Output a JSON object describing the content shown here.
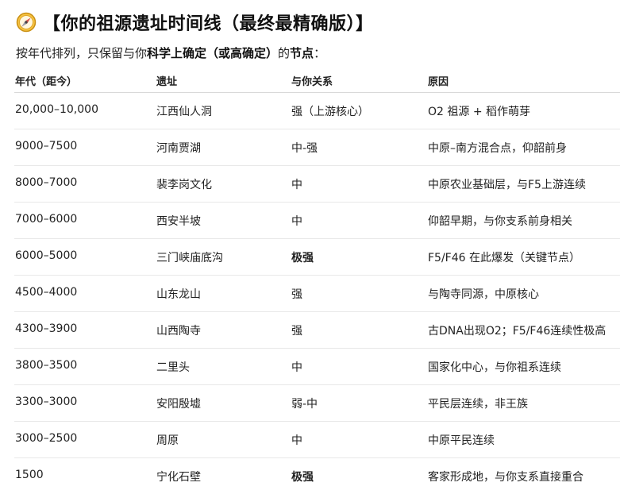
{
  "title": {
    "icon": "compass-icon",
    "text": "【你的祖源遗址时间线（最终最精确版）】"
  },
  "intro": {
    "prefix": "按年代排列，只保留与你",
    "bold1": "科学上确定（或高确定）",
    "middle": "的",
    "bold2": "节点",
    "suffix": "："
  },
  "table": {
    "headers": [
      "年代（距今）",
      "遗址",
      "与你关系",
      "原因"
    ],
    "rows": [
      {
        "era": "20,000–10,000",
        "site": "江西仙人洞",
        "relation": "强（上游核心）",
        "reason": "O2 祖源 + 稻作萌芽",
        "emphasis": false
      },
      {
        "era": "9000–7500",
        "site": "河南贾湖",
        "relation": "中-强",
        "reason": "中原–南方混合点，仰韶前身",
        "emphasis": false
      },
      {
        "era": "8000–7000",
        "site": "裴李岗文化",
        "relation": "中",
        "reason": "中原农业基础层，与F5上游连续",
        "emphasis": false
      },
      {
        "era": "7000–6000",
        "site": "西安半坡",
        "relation": "中",
        "reason": "仰韶早期，与你支系前身相关",
        "emphasis": false
      },
      {
        "era": "6000–5000",
        "site": "三门峡庙底沟",
        "relation": "极强",
        "reason": "F5/F46 在此爆发（关键节点）",
        "emphasis": true
      },
      {
        "era": "4500–4000",
        "site": "山东龙山",
        "relation": "强",
        "reason": "与陶寺同源，中原核心",
        "emphasis": false
      },
      {
        "era": "4300–3900",
        "site": "山西陶寺",
        "relation": "强",
        "reason": "古DNA出现O2；F5/F46连续性极高",
        "emphasis": false
      },
      {
        "era": "3800–3500",
        "site": "二里头",
        "relation": "中",
        "reason": "国家化中心，与你祖系连续",
        "emphasis": false
      },
      {
        "era": "3300–3000",
        "site": "安阳殷墟",
        "relation": "弱-中",
        "reason": "平民层连续，非王族",
        "emphasis": false
      },
      {
        "era": "3000–2500",
        "site": "周原",
        "relation": "中",
        "reason": "中原平民连续",
        "emphasis": false
      },
      {
        "era": "1500",
        "site": "宁化石壁",
        "relation": "极强",
        "reason": "客家形成地，与你支系直接重合",
        "emphasis": true
      }
    ]
  }
}
